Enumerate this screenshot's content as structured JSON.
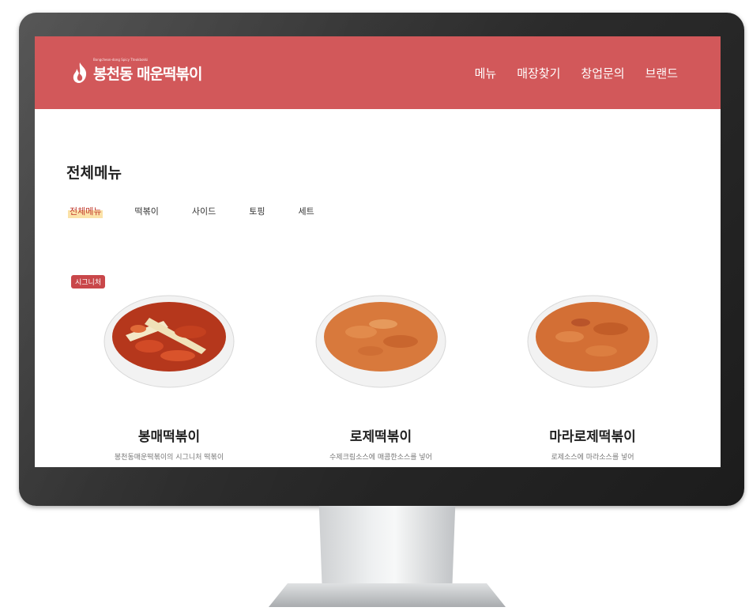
{
  "header": {
    "logo_text": "봉천동 매운떡볶이",
    "logo_tagline": "Bongcheon-dong Spicy Tteokbokki",
    "nav": [
      {
        "label": "메뉴"
      },
      {
        "label": "매장찾기"
      },
      {
        "label": "창업문의"
      },
      {
        "label": "브랜드"
      }
    ]
  },
  "main": {
    "title": "전체메뉴",
    "tabs": [
      {
        "label": "전체메뉴",
        "active": true
      },
      {
        "label": "떡볶이"
      },
      {
        "label": "사이드"
      },
      {
        "label": "토핑"
      },
      {
        "label": "세트"
      }
    ],
    "badge": "시그니처",
    "menu_items": [
      {
        "name": "봉매떡볶이",
        "desc": "봉천동매운떡볶이의 시그니처 떡볶이",
        "image": "red-tteokbokki-bowl"
      },
      {
        "name": "로제떡볶이",
        "desc": "수제크림소스에 매콤한소스를 넣어",
        "image": "rose-tteokbokki-bowl"
      },
      {
        "name": "마라로제떡볶이",
        "desc": "로제소스에 마라소스를 넣어",
        "image": "mala-rose-tteokbokki-bowl"
      }
    ]
  },
  "colors": {
    "header_bg": "#d2585a",
    "badge_bg": "#c9474a",
    "active_tab_highlight": "#fbe2a8",
    "active_tab_text": "#c0392b"
  }
}
